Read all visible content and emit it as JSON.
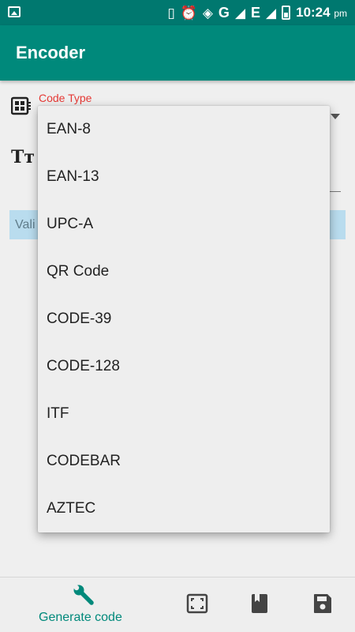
{
  "status_bar": {
    "network": "G",
    "network2": "E",
    "time": "10:24",
    "ampm": "pm",
    "icons": [
      "image-icon",
      "vibrate-icon",
      "alarm-icon",
      "wifi-icon",
      "signal-icon",
      "battery-icon"
    ]
  },
  "app_bar": {
    "title": "Encoder"
  },
  "form": {
    "code_type_label": "Code Type",
    "text_icon": "Tт",
    "valid_text": "Vali"
  },
  "dropdown": {
    "options": [
      "EAN-8",
      "EAN-13",
      "UPC-A",
      "QR Code",
      "CODE-39",
      "CODE-128",
      "ITF",
      "CODEBAR",
      "AZTEC"
    ]
  },
  "bottom_nav": {
    "generate_label": "Generate code",
    "icons": [
      "wrench-icon",
      "fullscreen-icon",
      "book-icon",
      "save-icon"
    ]
  },
  "colors": {
    "primary": "#00897b",
    "primary_dark": "#00786f",
    "label_red": "#e53935",
    "valid_bg": "#b9dcee"
  }
}
